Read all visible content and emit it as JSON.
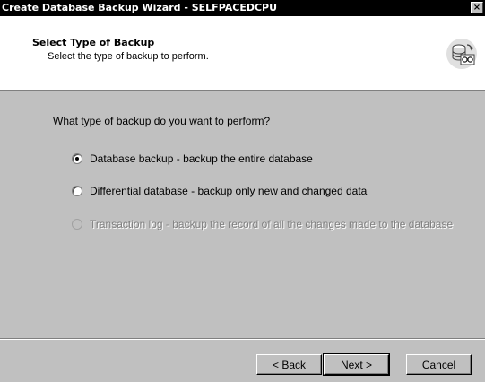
{
  "window": {
    "title": "Create Database Backup Wizard - SELFPACEDCPU",
    "close_glyph": "×"
  },
  "header": {
    "title": "Select Type of Backup",
    "subtitle": "Select the type of backup to perform.",
    "icon": "database-backup-icon"
  },
  "body": {
    "question": "What type of backup do you want to perform?",
    "options": [
      {
        "label": "Database backup - backup the entire database",
        "selected": true,
        "enabled": true
      },
      {
        "label": "Differential database - backup only new and changed data",
        "selected": false,
        "enabled": true
      },
      {
        "label": "Transaction log - backup the record of all the changes made to the database",
        "selected": false,
        "enabled": false
      }
    ]
  },
  "footer": {
    "back_label": "< Back",
    "next_label": "Next >",
    "cancel_label": "Cancel"
  }
}
